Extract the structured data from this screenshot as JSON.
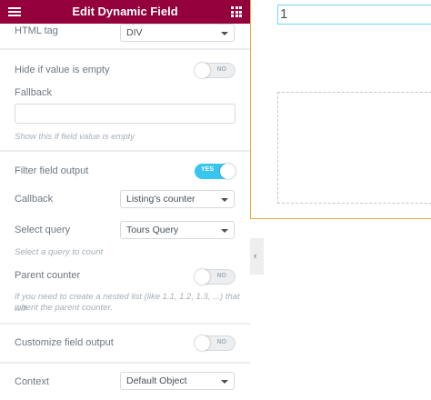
{
  "header": {
    "title": "Edit Dynamic Field",
    "menu_icon": "hamburger-icon",
    "apps_icon": "grid-icon",
    "color": "#93003c"
  },
  "controls": {
    "html_tag": {
      "label": "HTML tag",
      "value": "DIV"
    },
    "hide_if_empty": {
      "label": "Hide if value is empty",
      "state": "NO"
    },
    "fallback": {
      "label": "Fallback",
      "value": "",
      "description": "Show this if field value is empty"
    },
    "filter_output": {
      "label": "Filter field output",
      "state": "YES"
    },
    "callback": {
      "label": "Callback",
      "value": "Listing's counter"
    },
    "select_query": {
      "label": "Select query",
      "value": "Tours Query",
      "description": "Select a query to count"
    },
    "parent_counter": {
      "label": "Parent counter",
      "state": "NO",
      "description_line1": "If you need to create a nested list (like 1.1, 1.2, 1.3, ...) that will",
      "description_line2": "inherit the parent counter."
    },
    "customize_output": {
      "label": "Customize field output",
      "state": "NO"
    },
    "context": {
      "label": "Context",
      "value": "Default Object"
    }
  },
  "collapse_icon": "chevron-left-icon",
  "collapse_glyph": "‹",
  "preview": {
    "field_value": "1"
  },
  "colors": {
    "toggle_on": "#38c5f0",
    "preview_border": "#f0a838",
    "field_highlight": "#71d7f7"
  }
}
